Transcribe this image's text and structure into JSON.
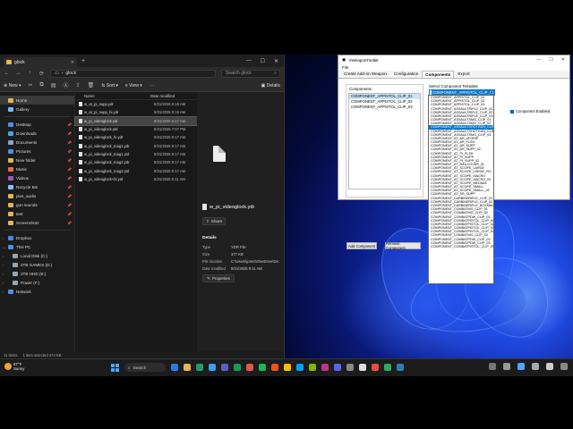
{
  "explorer": {
    "tab_title": "glock",
    "address": "glock",
    "search_placeholder": "Search glock",
    "new_label": "New",
    "sort_label": "Sort",
    "view_label": "View",
    "details_label": "Details",
    "nav": [
      {
        "label": "Home",
        "color": "#e8b44c"
      },
      {
        "label": "Gallery",
        "color": "#6fb7ff"
      }
    ],
    "quick": [
      {
        "label": "Desktop",
        "color": "#4a90e2"
      },
      {
        "label": "Downloads",
        "color": "#3fa9f5"
      },
      {
        "label": "Documents",
        "color": "#8aa4c8"
      },
      {
        "label": "Pictures",
        "color": "#4a90e2"
      },
      {
        "label": "New folder",
        "color": "#e8b44c"
      },
      {
        "label": "Music",
        "color": "#e86a4c"
      },
      {
        "label": "Videos",
        "color": "#9b59b6"
      },
      {
        "label": "Recycle Bin",
        "color": "#7ec4ff"
      },
      {
        "label": "plus_audio",
        "color": "#e8b44c"
      },
      {
        "label": "gun sounds",
        "color": "#e8b44c"
      },
      {
        "label": "test",
        "color": "#e8b44c"
      },
      {
        "label": "Screenshots",
        "color": "#e8b44c"
      }
    ],
    "drives": [
      {
        "label": "Dropbox",
        "color": "#3d8bfd"
      },
      {
        "label": "This PC",
        "color": "#4a90e2"
      },
      {
        "label": "Local Disk (C:)",
        "color": "#9aa5b1"
      },
      {
        "label": "2TB GAMES (D:)",
        "color": "#9aa5b1"
      },
      {
        "label": "2TB HHD (E:)",
        "color": "#9aa5b1"
      },
      {
        "label": "Power (F:)",
        "color": "#9aa5b1"
      },
      {
        "label": "Network",
        "color": "#4a90e2"
      }
    ],
    "columns": {
      "name": "Name",
      "date": "Date modified"
    },
    "files": [
      {
        "name": "w_at_pi_supp.ydr",
        "date": "8/31/2025 9:18 AM"
      },
      {
        "name": "w_at_pi_supp_hi.ydr",
        "date": "8/31/2025 9:18 AM"
      },
      {
        "name": "w_pi_videoglock.ydr",
        "date": "8/31/2025 9:17 AM"
      },
      {
        "name": "w_pi_videoglock.ytd",
        "date": "8/31/2025 7:07 PM"
      },
      {
        "name": "w_pi_videoglock_hi.ydr",
        "date": "8/31/2025 9:17 AM"
      },
      {
        "name": "w_pi_videoglock_mag1.ydr",
        "date": "8/31/2025 9:17 AM"
      },
      {
        "name": "w_pi_videoglock_mag1.ytd",
        "date": "8/31/2025 9:17 AM"
      },
      {
        "name": "w_pi_videoglock_mag2.ydr",
        "date": "8/31/2025 9:17 AM"
      },
      {
        "name": "w_pi_videoglock_mag2.ytd",
        "date": "8/31/2025 9:17 AM"
      },
      {
        "name": "w_pi_videoglock+hi.ytd",
        "date": "8/31/2025 9:11 AM"
      }
    ],
    "selected_index": 2,
    "preview_name": "w_pi_videoglock.ydr",
    "share_label": "Share",
    "details_heading": "Details",
    "props": [
      {
        "k": "Type",
        "v": "YDR File"
      },
      {
        "k": "Size",
        "v": "377 KB"
      },
      {
        "k": "File location",
        "v": "C:\\Users\\jones\\OneDrive\\De..."
      },
      {
        "k": "Date modified",
        "v": "8/31/2025 9:11 AM"
      }
    ],
    "properties_label": "Properties",
    "status_items": "11 items",
    "status_selected": "1 item selected  472 KB"
  },
  "toolkit": {
    "title": "VWeaponToolkit",
    "menu_file": "File",
    "tabs": [
      "Create Add-on Weapon",
      "Configuration",
      "Components",
      "Export"
    ],
    "active_tab": 2,
    "components_label": "Components",
    "components": [
      "COMPONENT_APPISTOL_CLIP_01",
      "COMPONENT_APPISTOL_CLIP_02",
      "COMPONENT_APPISTOL_CLIP_03"
    ],
    "add_button": "Add Component",
    "remove_button": "Remove Component",
    "template_label": "Select Component Template",
    "template_value": "COMPONENT_APPISTOL_CLIP_01",
    "enabled_label": "Component Enabled"
  },
  "dropdown": {
    "items": [
      "COMPONENT_APPISTOL_CLIP_01",
      "COMPONENT_APPISTOL_CLIP_02",
      "COMPONENT_APPISTOL_CLIP_03",
      "COMPONENT_ASSAULTRIFLE_CLIP_01",
      "COMPONENT_ASSAULTRIFLE_CLIP_02",
      "COMPONENT_ASSAULTRIFLE_CLIP_03",
      "COMPONENT_ASSAULTSMG_CLIP_01",
      "COMPONENT_ASSAULTSMG_CLIP_02",
      "COMPONENT_ASSAULTSHOTGUN_CLIP_01",
      "COMPONENT_ASSAULTSHOTGUN_CLIP_02",
      "COMPONENT_ASSAULTSMG_CLIP_03",
      "COMPONENT_AT_AR_AFGRIP",
      "COMPONENT_AT_AR_FLSH",
      "COMPONENT_AT_AR_SUPP",
      "COMPONENT_AT_AR_SUPP_02",
      "COMPONENT_AT_PI_FLSH",
      "COMPONENT_AT_PI_SUPP",
      "COMPONENT_AT_PI_SUPP_02",
      "COMPONENT_AT_RAILCOVER_01",
      "COMPONENT_AT_SCOPE_LARGE",
      "COMPONENT_AT_SCOPE_LARGE_FIX",
      "COMPONENT_AT_SCOPE_MACRO",
      "COMPONENT_AT_SCOPE_MACRO_02",
      "COMPONENT_AT_SCOPE_MEDIUM",
      "COMPONENT_AT_SCOPE_SMALL",
      "COMPONENT_AT_SCOPE_SMALL_02",
      "COMPONENT_AT_SR_SUPP",
      "COMPONENT_CARBINERIFLE_CLIP_01",
      "COMPONENT_CARBINERIFLE_CLIP_02",
      "COMPONENT_CARBINERIFLE_BOXMAG",
      "COMPONENT_COMBATMG_CLIP_01",
      "COMPONENT_COMBATMG_CLIP_02",
      "COMPONENT_COMBATPDW_CLIP_01",
      "COMPONENT_COMBATPISTOL_CLIP_01",
      "COMPONENT_COMBATPISTOL_CLIP_02",
      "COMPONENT_COMBATPISTOL_CLIP_03",
      "COMPONENT_COMBATPISTOL_CLIP_04",
      "COMPONENT_COMBATMG_CLIP_03",
      "COMPONENT_COMBATPDW_CLIP_02",
      "COMPONENT_COMBATPDW_CLIP_03",
      "COMPONENT_COMBATPISTOL_CLIP_05"
    ],
    "selected_index": 8
  },
  "taskbar": {
    "weather_temp": "87°F",
    "weather_desc": "Sunny",
    "search_label": "Search",
    "apps": [
      "#2d7be5",
      "#e8b44c",
      "#1e9e6a",
      "#3aa0f0",
      "#5b5fc7",
      "#0f9d58",
      "#e2574c",
      "#1db954",
      "#f25022",
      "#ffb900",
      "#00a4ef",
      "#7fba00",
      "#c13584",
      "#5865f2",
      "#888888",
      "#dddddd",
      "#e74c3c",
      "#27ae60",
      "#2980b9"
    ],
    "tray": [
      "#777",
      "#999",
      "#4aa8ff",
      "#aaa",
      "#ccc",
      "#888"
    ]
  }
}
